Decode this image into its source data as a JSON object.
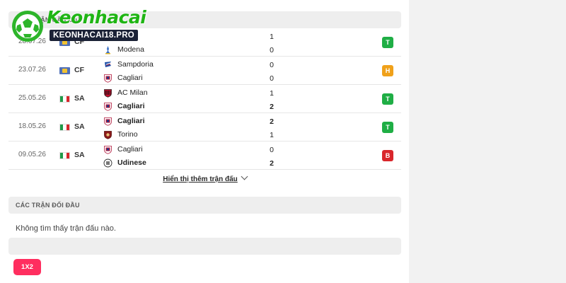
{
  "section_recent": {
    "title": "CÁC TRẬN GẦN ĐÂY"
  },
  "matches": [
    {
      "date": "28.07.26",
      "comp": "CF",
      "flag": "cf-icon",
      "home": {
        "name": "",
        "crest": "team-crest-icon",
        "bold": false,
        "score": "1"
      },
      "away": {
        "name": "Modena",
        "crest": "modena-crest-icon",
        "bold": false,
        "score": "0"
      },
      "result": "T",
      "result_color": "#1fae45"
    },
    {
      "date": "23.07.26",
      "comp": "CF",
      "flag": "cf-icon",
      "home": {
        "name": "Sampdoria",
        "crest": "sampdoria-crest-icon",
        "bold": false,
        "score": "0"
      },
      "away": {
        "name": "Cagliari",
        "crest": "cagliari-crest-icon",
        "bold": false,
        "score": "0"
      },
      "result": "H",
      "result_color": "#f0a11a"
    },
    {
      "date": "25.05.26",
      "comp": "SA",
      "flag": "italy-flag-icon",
      "home": {
        "name": "AC Milan",
        "crest": "ac-milan-crest-icon",
        "bold": false,
        "score": "1"
      },
      "away": {
        "name": "Cagliari",
        "crest": "cagliari-crest-icon",
        "bold": true,
        "score": "2"
      },
      "result": "T",
      "result_color": "#1fae45"
    },
    {
      "date": "18.05.26",
      "comp": "SA",
      "flag": "italy-flag-icon",
      "home": {
        "name": "Cagliari",
        "crest": "cagliari-crest-icon",
        "bold": true,
        "score": "2"
      },
      "away": {
        "name": "Torino",
        "crest": "torino-crest-icon",
        "bold": false,
        "score": "1"
      },
      "result": "T",
      "result_color": "#1fae45"
    },
    {
      "date": "09.05.26",
      "comp": "SA",
      "flag": "italy-flag-icon",
      "home": {
        "name": "Cagliari",
        "crest": "cagliari-crest-icon",
        "bold": false,
        "score": "0"
      },
      "away": {
        "name": "Udinese",
        "crest": "udinese-crest-icon",
        "bold": true,
        "score": "2"
      },
      "result": "B",
      "result_color": "#d9262b"
    }
  ],
  "show_more": {
    "label": "Hiển thị thêm trận đấu"
  },
  "section_h2h": {
    "title": "CÁC TRẬN ĐỐI ĐẦU",
    "empty_text": "Không tìm thấy trận đấu nào."
  },
  "odds_button": {
    "label": "1X2"
  },
  "watermark": {
    "title": "Keonhacai",
    "subtitle": "KEONHACAI18.PRO"
  }
}
